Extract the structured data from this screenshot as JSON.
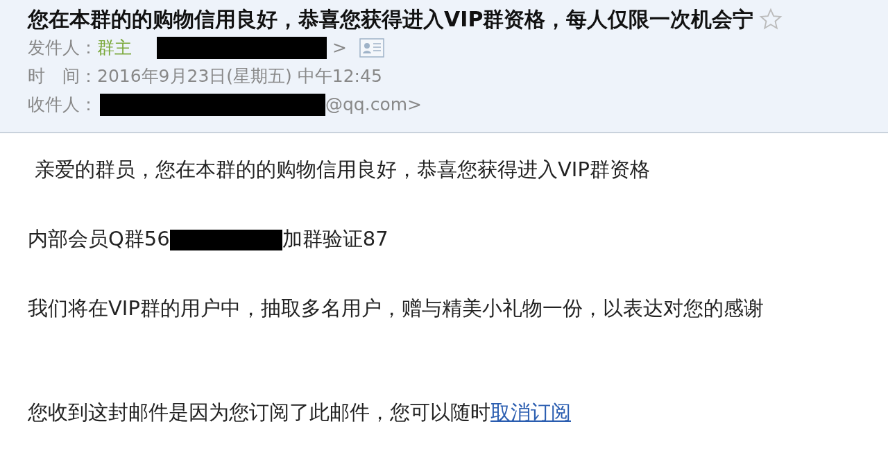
{
  "email": {
    "subject": "您在本群的的购物信用良好，恭喜您获得进入VIP群资格，每人仅限一次机会宁",
    "starred": false,
    "from": {
      "label": "发件人：",
      "name": "群主",
      "suffix": ">"
    },
    "time": {
      "label": "时　间：",
      "value": "2016年9月23日(星期五) 中午12:45"
    },
    "to": {
      "label": "收件人：",
      "suffix": "@qq.com>"
    }
  },
  "body": [
    {
      "kind": "text",
      "text": "亲爱的群员，您在本群的的购物信用良好，恭喜您获得进入VIP群资格"
    },
    {
      "kind": "redacted",
      "before": "内部会员Q群56",
      "after": "加群验证87"
    },
    {
      "kind": "text",
      "text": "我们将在VIP群的用户中，抽取多名用户，赠与精美小礼物一份，以表达对您的感谢"
    }
  ],
  "footer": {
    "text": "您收到这封邮件是因为您订阅了此邮件，您可以随时",
    "link": "取消订阅"
  }
}
